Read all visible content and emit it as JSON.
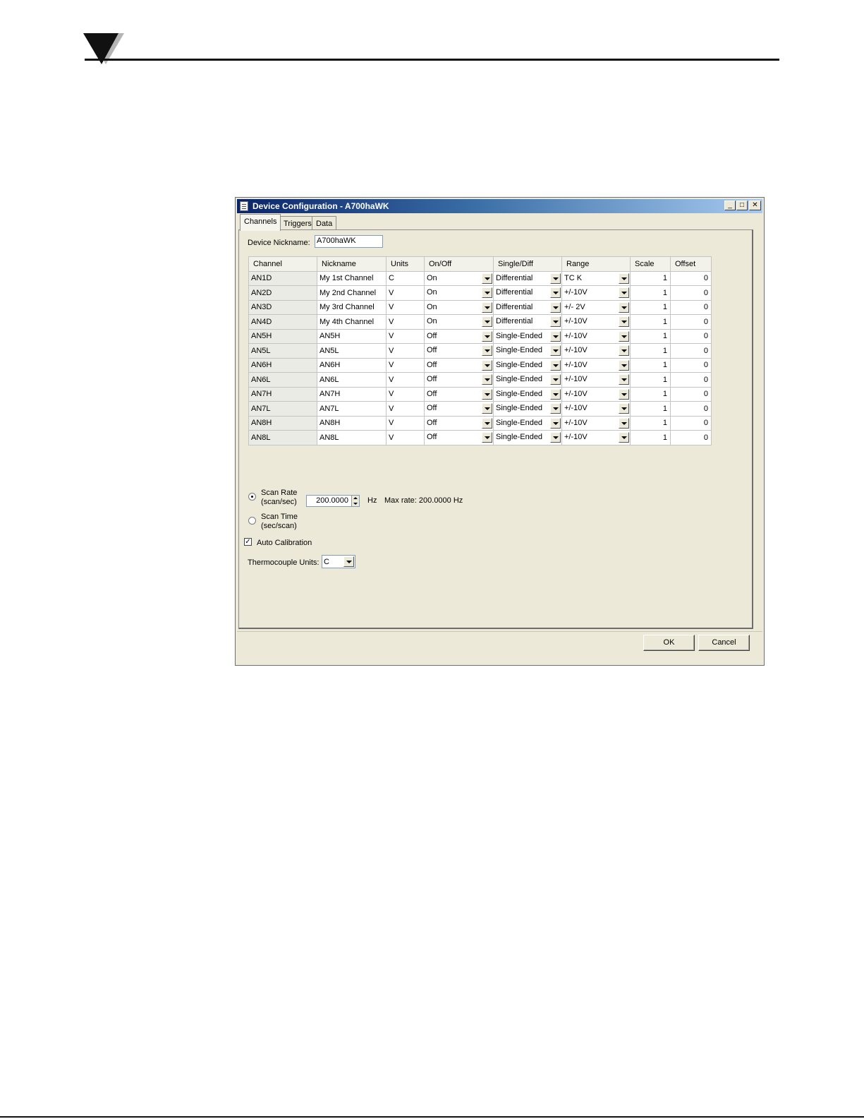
{
  "window": {
    "title": "Device Configuration - A700haWK",
    "minimize_glyph": "_",
    "maximize_glyph": "□",
    "close_glyph": "✕"
  },
  "tabs": [
    {
      "label": "Channels",
      "active": true
    },
    {
      "label": "Triggers",
      "active": false
    },
    {
      "label": "Data",
      "active": false
    }
  ],
  "device_nickname": {
    "label": "Device Nickname:",
    "value": "A700haWK"
  },
  "grid": {
    "columns": [
      "Channel",
      "Nickname",
      "Units",
      "On/Off",
      "Single/Diff",
      "Range",
      "Scale",
      "Offset"
    ],
    "rows": [
      {
        "channel": "AN1D",
        "nickname": "My 1st Channel",
        "units": "C",
        "onoff": "On",
        "singlediff": "Differential",
        "range": "TC K",
        "scale": "1",
        "offset": "0"
      },
      {
        "channel": "AN2D",
        "nickname": "My 2nd Channel",
        "units": "V",
        "onoff": "On",
        "singlediff": "Differential",
        "range": "+/-10V",
        "scale": "1",
        "offset": "0"
      },
      {
        "channel": "AN3D",
        "nickname": "My 3rd Channel",
        "units": "V",
        "onoff": "On",
        "singlediff": "Differential",
        "range": "+/- 2V",
        "scale": "1",
        "offset": "0"
      },
      {
        "channel": "AN4D",
        "nickname": "My 4th Channel",
        "units": "V",
        "onoff": "On",
        "singlediff": "Differential",
        "range": "+/-10V",
        "scale": "1",
        "offset": "0"
      },
      {
        "channel": "AN5H",
        "nickname": "AN5H",
        "units": "V",
        "onoff": "Off",
        "singlediff": "Single-Ended",
        "range": "+/-10V",
        "scale": "1",
        "offset": "0"
      },
      {
        "channel": "AN5L",
        "nickname": "AN5L",
        "units": "V",
        "onoff": "Off",
        "singlediff": "Single-Ended",
        "range": "+/-10V",
        "scale": "1",
        "offset": "0"
      },
      {
        "channel": "AN6H",
        "nickname": "AN6H",
        "units": "V",
        "onoff": "Off",
        "singlediff": "Single-Ended",
        "range": "+/-10V",
        "scale": "1",
        "offset": "0"
      },
      {
        "channel": "AN6L",
        "nickname": "AN6L",
        "units": "V",
        "onoff": "Off",
        "singlediff": "Single-Ended",
        "range": "+/-10V",
        "scale": "1",
        "offset": "0"
      },
      {
        "channel": "AN7H",
        "nickname": "AN7H",
        "units": "V",
        "onoff": "Off",
        "singlediff": "Single-Ended",
        "range": "+/-10V",
        "scale": "1",
        "offset": "0"
      },
      {
        "channel": "AN7L",
        "nickname": "AN7L",
        "units": "V",
        "onoff": "Off",
        "singlediff": "Single-Ended",
        "range": "+/-10V",
        "scale": "1",
        "offset": "0"
      },
      {
        "channel": "AN8H",
        "nickname": "AN8H",
        "units": "V",
        "onoff": "Off",
        "singlediff": "Single-Ended",
        "range": "+/-10V",
        "scale": "1",
        "offset": "0"
      },
      {
        "channel": "AN8L",
        "nickname": "AN8L",
        "units": "V",
        "onoff": "Off",
        "singlediff": "Single-Ended",
        "range": "+/-10V",
        "scale": "1",
        "offset": "0"
      }
    ]
  },
  "scan": {
    "rate_label_1": "Scan Rate",
    "rate_label_2": "(scan/sec)",
    "time_label_1": "Scan Time",
    "time_label_2": "(sec/scan)",
    "rate_selected": true,
    "value": "200.0000",
    "unit": "Hz",
    "max_rate": "Max rate: 200.0000 Hz"
  },
  "auto_calibration": {
    "label": "Auto Calibration",
    "checked": true
  },
  "thermocouple_units": {
    "label": "Thermocouple Units:",
    "value": "C"
  },
  "buttons": {
    "ok": "OK",
    "cancel": "Cancel"
  },
  "colors": {
    "title_start": "#0a246a",
    "title_end": "#a6caf0",
    "dialog_bg": "#ece9d8"
  }
}
